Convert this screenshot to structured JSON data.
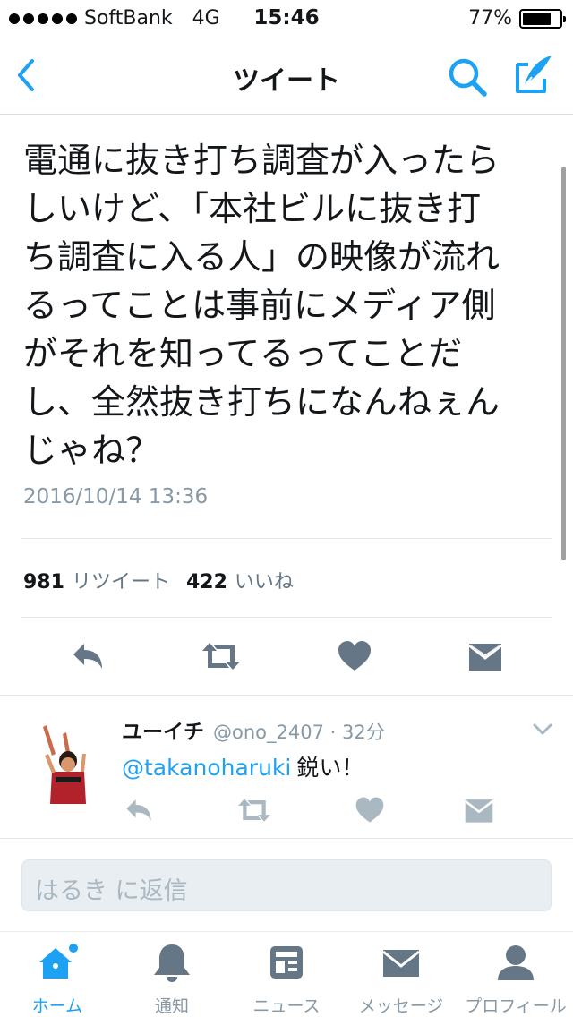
{
  "status_bar": {
    "carrier": "SoftBank",
    "network": "4G",
    "time": "15:46",
    "battery_percent": "77%",
    "battery_level": 0.77
  },
  "nav": {
    "title": "ツイート",
    "back_icon": "chevron-left-icon",
    "search_icon": "search-icon",
    "compose_icon": "compose-icon"
  },
  "tweet": {
    "text_lines": [
      "電通に抜き打ち調査が入ったら",
      "しいけど、「本社ビルに抜き打",
      "ち調査に入る人」の映像が流れ",
      "るってことは事前にメディア側",
      "がそれを知ってるってことだ",
      "し、全然抜き打ちになんねぇん",
      "じゃね？"
    ],
    "date": "2016/10/14 13:36",
    "retweet_count": "981",
    "retweet_label": "リツイート",
    "like_count": "422",
    "like_label": "いいね"
  },
  "reply": {
    "name": "ユーイチ",
    "handle_time": "@ono_2407 · 32分",
    "mention": "@takanoharuki",
    "text": "鋭い！"
  },
  "reply_box": {
    "placeholder": "はるき に返信"
  },
  "tabs": [
    {
      "label": "ホーム",
      "icon": "home-icon",
      "active": true
    },
    {
      "label": "通知",
      "icon": "bell-icon",
      "active": false
    },
    {
      "label": "ニュース",
      "icon": "news-icon",
      "active": false
    },
    {
      "label": "メッセージ",
      "icon": "mail-icon",
      "active": false
    },
    {
      "label": "プロフィール",
      "icon": "profile-icon",
      "active": false
    }
  ],
  "colors": {
    "accent": "#1da1f2",
    "icon_gray": "#657786",
    "light_gray": "#8899a6"
  }
}
